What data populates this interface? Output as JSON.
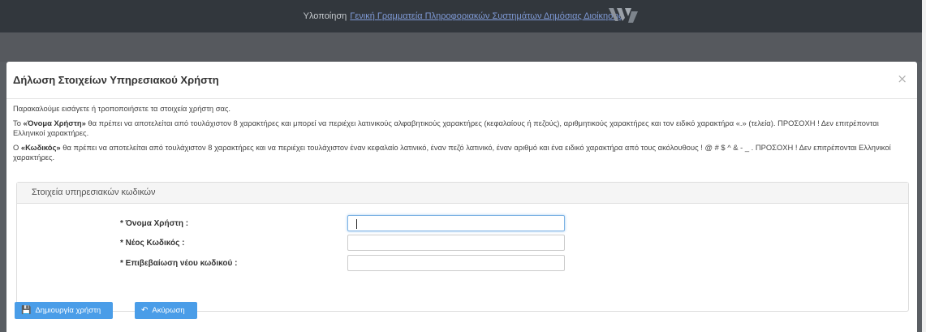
{
  "topbar": {
    "prefix": "Υλοποίηση",
    "link_text": "Γενική Γραμματεία Πληροφοριακών Συστημάτων Δημόσιας Διοίκησης"
  },
  "modal": {
    "title": "Δήλωση Στοιχείων Υπηρεσιακού Χρήστη",
    "close_symbol": "×",
    "intro": "Παρακαλούμε εισάγετε ή τροποποιήσετε τα στοιχεία χρήστη σας.",
    "username_rule_lead": "Το ",
    "username_rule_term": "«Όνομα Χρήστη»",
    "username_rule_text": " θα πρέπει να αποτελείται από τουλάχιστον 8 χαρακτήρες και μπορεί να περιέχει λατινικούς αλφαβητικούς χαρακτήρες (κεφαλαίους ή πεζούς), αριθμητικούς χαρακτήρες και τον ειδικό χαρακτήρα «.» (τελεία). ΠΡΟΣΟΧΗ ! Δεν επιτρέπονται Ελληνικοί χαρακτήρες.",
    "password_rule_lead": "Ο ",
    "password_rule_term": "«Κωδικός»",
    "password_rule_text": " θα πρέπει να αποτελείται από τουλάχιστον 8 χαρακτήρες και να περιέχει τουλάχιστον έναν κεφαλαίο λατινικό, έναν πεζό λατινικό, έναν αριθμό και ένα ειδικό χαρακτήρα από τους ακόλουθους ! @ # $ ^ & - _ . ΠΡΟΣΟΧΗ ! Δεν επιτρέπονται Ελληνικοί χαρακτήρες.",
    "panel_title": "Στοιχεία υπηρεσιακών κωδικών",
    "fields": {
      "username_label": "* Όνομα Χρήστη :",
      "username_value": "",
      "password_label": "* Νέος Κωδικός :",
      "password_value": "",
      "confirm_label": "* Επιβεβαίωση νέου κωδικού :",
      "confirm_value": ""
    },
    "buttons": {
      "create_label": "Δημιουργία χρήστη",
      "cancel_label": "Ακύρωση"
    }
  },
  "colors": {
    "primary": "#4a9de8",
    "topbar": "#32373d",
    "link": "#7f9ad6"
  }
}
